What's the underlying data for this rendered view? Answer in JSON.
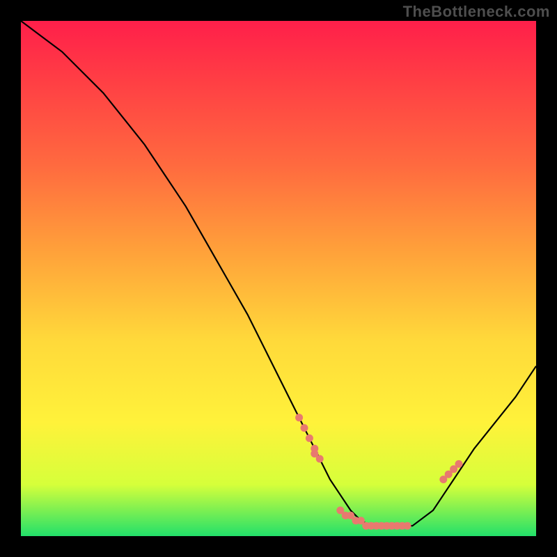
{
  "watermark": "TheBottleneck.com",
  "chart_data": {
    "type": "line",
    "title": "",
    "xlabel": "",
    "ylabel": "",
    "xlim": [
      0,
      100
    ],
    "ylim": [
      0,
      100
    ],
    "grid": false,
    "legend": false,
    "x": [
      0,
      4,
      8,
      12,
      16,
      20,
      24,
      28,
      32,
      36,
      40,
      44,
      48,
      52,
      56,
      58,
      60,
      62,
      64,
      66,
      68,
      72,
      76,
      80,
      82,
      84,
      88,
      92,
      96,
      100
    ],
    "y": [
      100,
      97,
      94,
      90,
      86,
      81,
      76,
      70,
      64,
      57,
      50,
      43,
      35,
      27,
      19,
      15,
      11,
      8,
      5,
      3,
      2,
      2,
      2,
      5,
      8,
      11,
      17,
      22,
      27,
      33
    ],
    "markers": {
      "x": [
        54,
        55,
        56,
        57,
        57,
        58,
        62,
        63,
        64,
        65,
        66,
        67,
        68,
        69,
        70,
        71,
        72,
        73,
        74,
        75,
        82,
        83,
        84,
        85
      ],
      "y": [
        23,
        21,
        19,
        17,
        16,
        15,
        5,
        4,
        4,
        3,
        3,
        2,
        2,
        2,
        2,
        2,
        2,
        2,
        2,
        2,
        11,
        12,
        13,
        14
      ]
    }
  }
}
